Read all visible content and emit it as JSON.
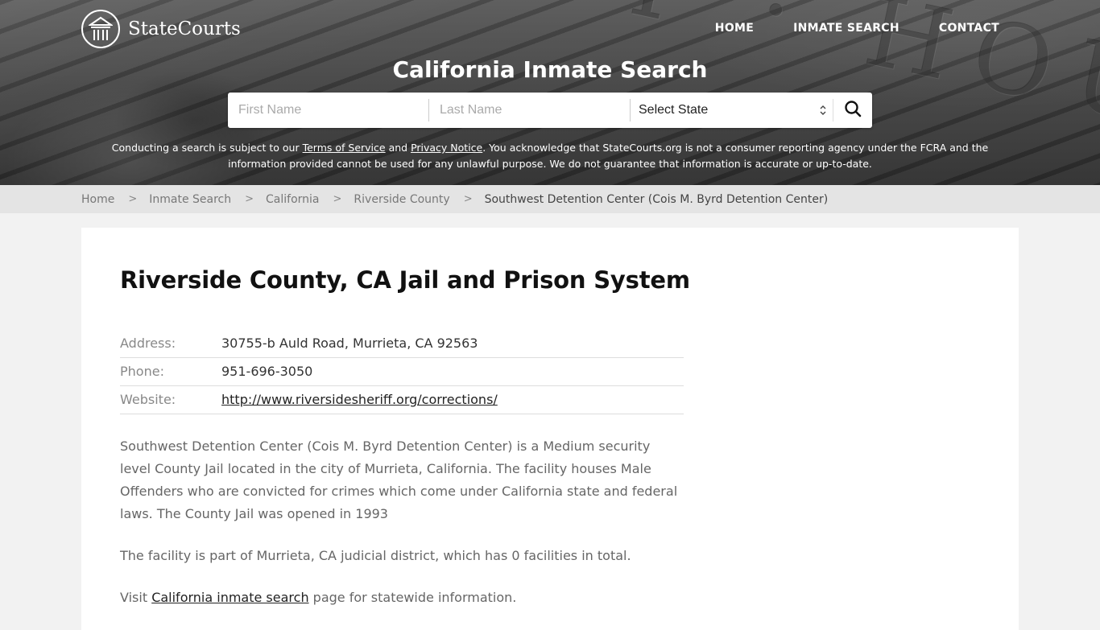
{
  "brand": {
    "name": "StateCourts",
    "logo_icon": "courthouse-icon"
  },
  "nav": {
    "items": [
      {
        "label": "HOME"
      },
      {
        "label": "INMATE SEARCH"
      },
      {
        "label": "CONTACT"
      }
    ]
  },
  "hero": {
    "title": "California Inmate Search",
    "background_text": "T · HOUSE"
  },
  "search": {
    "first_name_placeholder": "First Name",
    "first_name_value": "",
    "last_name_placeholder": "Last Name",
    "last_name_value": "",
    "state_selected": "Select State",
    "button_icon": "search-icon"
  },
  "disclaimer": {
    "part1": "Conducting a search is subject to our ",
    "terms_link": "Terms of Service",
    "part2": " and ",
    "privacy_link": "Privacy Notice",
    "part3": ". You acknowledge that StateCourts.org is not a consumer reporting agency under the FCRA and the information provided cannot be used for any unlawful purpose. We do not guarantee that information is accurate or up-to-date."
  },
  "breadcrumb": {
    "items": [
      {
        "label": "Home"
      },
      {
        "label": "Inmate Search"
      },
      {
        "label": "California"
      },
      {
        "label": "Riverside County"
      }
    ],
    "current": "Southwest Detention Center (Cois M. Byrd Detention Center)"
  },
  "main": {
    "title": "Riverside County, CA Jail and Prison System",
    "info": {
      "address_label": "Address:",
      "address_value": "30755-b Auld Road, Murrieta, CA 92563",
      "phone_label": "Phone:",
      "phone_value": "951-696-3050",
      "website_label": "Website:",
      "website_value": "http://www.riversidesheriff.org/corrections/"
    },
    "description": "Southwest Detention Center (Cois M. Byrd Detention Center) is a Medium security level County Jail located in the city of Murrieta, California. The facility houses Male Offenders who are convicted for crimes which come under California state and federal laws. The County Jail was opened in 1993",
    "district_text": "The facility is part of Murrieta, CA judicial district, which has 0 facilities in total.",
    "visit_prefix": "Visit ",
    "visit_link": "California inmate search",
    "visit_suffix": " page for statewide information."
  }
}
